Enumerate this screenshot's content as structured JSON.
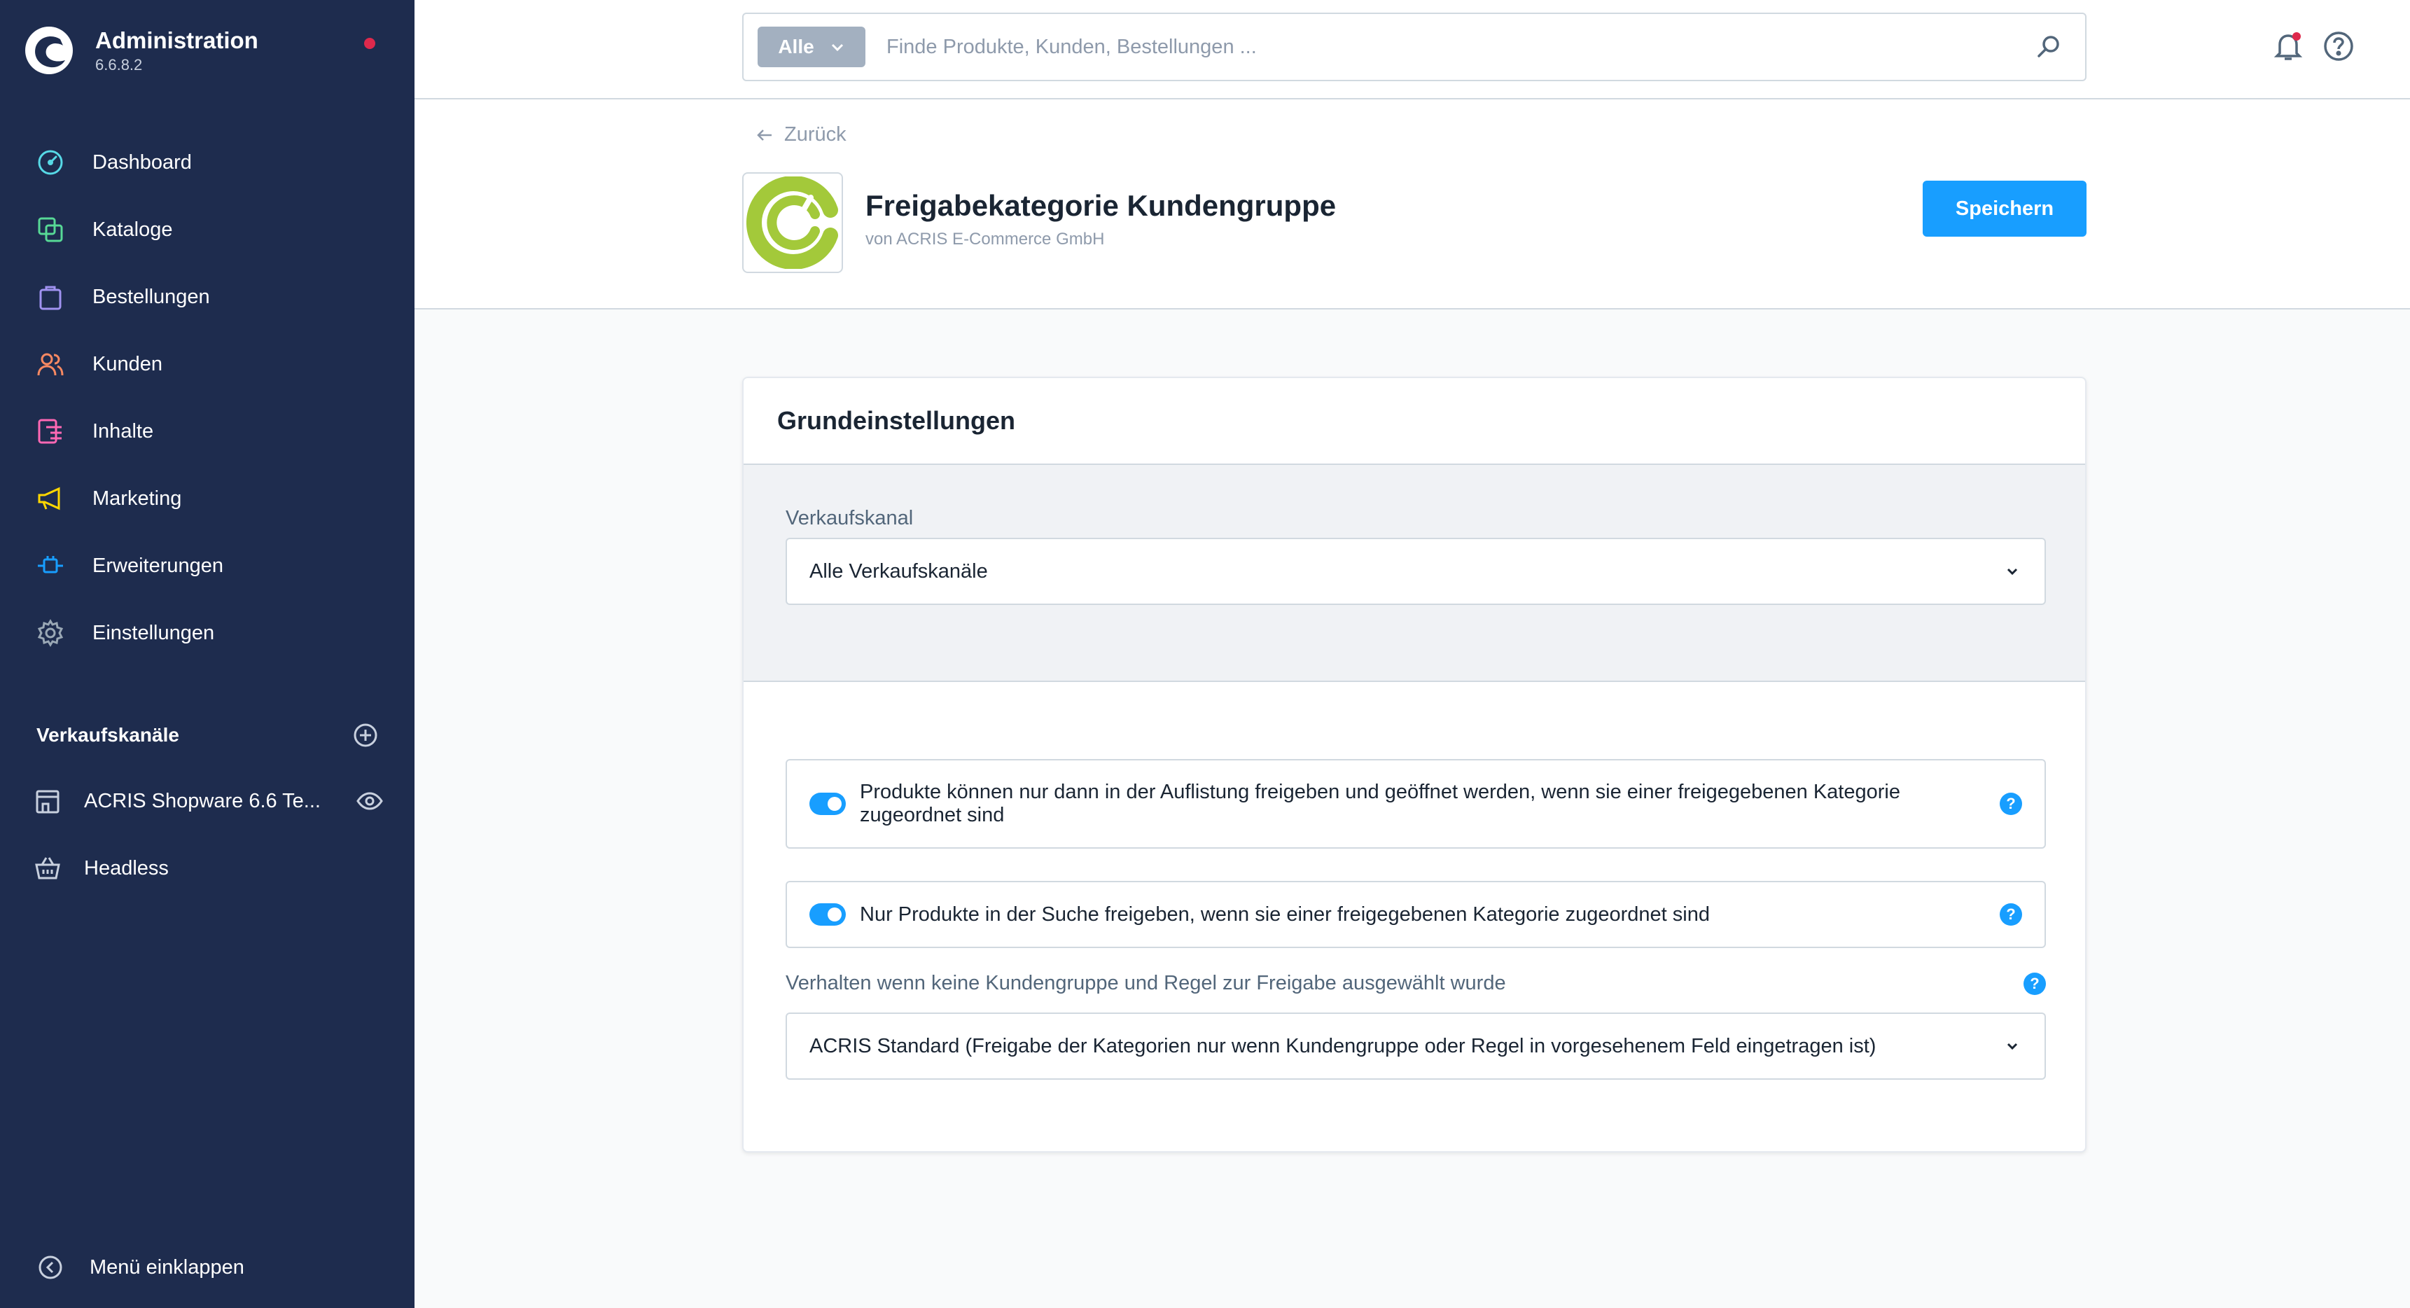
{
  "app": {
    "title": "Administration",
    "version": "6.6.8.2",
    "notification_color": "#de294c"
  },
  "sidebar": {
    "items": [
      {
        "label": "Dashboard",
        "icon": "dashboard-icon",
        "color": "#57d9e6"
      },
      {
        "label": "Kataloge",
        "icon": "catalog-icon",
        "color": "#57d996"
      },
      {
        "label": "Bestellungen",
        "icon": "orders-icon",
        "color": "#a092f0"
      },
      {
        "label": "Kunden",
        "icon": "customers-icon",
        "color": "#f88962"
      },
      {
        "label": "Inhalte",
        "icon": "content-icon",
        "color": "#ff68b4"
      },
      {
        "label": "Marketing",
        "icon": "marketing-icon",
        "color": "#ffd700"
      },
      {
        "label": "Erweiterungen",
        "icon": "extensions-icon",
        "color": "#189eff"
      },
      {
        "label": "Einstellungen",
        "icon": "settings-icon",
        "color": "#9aa8b5"
      }
    ],
    "sales_channels_title": "Verkaufskanäle",
    "sales_channels": [
      {
        "label": "ACRIS Shopware 6.6 Te...",
        "icon": "storefront-icon"
      },
      {
        "label": "Headless",
        "icon": "basket-icon"
      }
    ],
    "collapse_label": "Menü einklappen"
  },
  "topbar": {
    "search_filter": "Alle",
    "search_placeholder": "Finde Produkte, Kunden, Bestellungen ..."
  },
  "header": {
    "back_label": "Zurück",
    "plugin_title": "Freigabekategorie Kundengruppe",
    "plugin_vendor": "von ACRIS E-Commerce GmbH",
    "save_label": "Speichern",
    "accent_color": "#189eff",
    "logo_color": "#a3c93a"
  },
  "card": {
    "title": "Grundeinstellungen",
    "sales_channel_label": "Verkaufskanal",
    "sales_channel_value": "Alle Verkaufskanäle",
    "toggle1_label": "Produkte können nur dann in der Auflistung freigeben und geöffnet werden, wenn sie einer freigegebenen Kategorie zugeordnet sind",
    "toggle1_on": true,
    "toggle2_label": "Nur Produkte in der Suche freigeben, wenn sie einer freigegebenen Kategorie zugeordnet sind",
    "toggle2_on": true,
    "behaviour_label": "Verhalten wenn keine Kundengruppe und Regel zur Freigabe ausgewählt wurde",
    "behaviour_value": "ACRIS Standard (Freigabe der Kategorien nur wenn Kundengruppe oder Regel in vorgesehenem Feld eingetragen ist)",
    "help_glyph": "?"
  }
}
